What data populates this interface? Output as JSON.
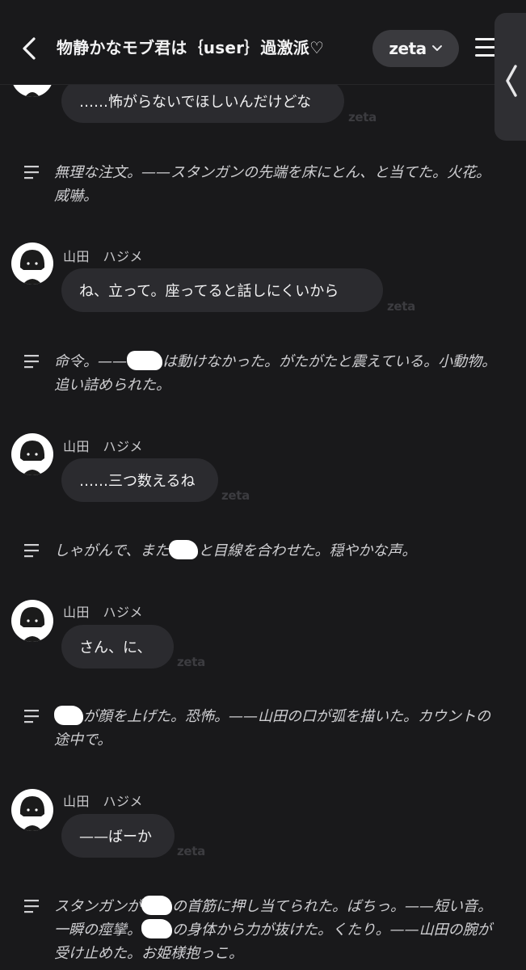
{
  "header": {
    "back_label": "back",
    "title": "物静かなモブ君は｛user｝過激派",
    "title_heart": "♡",
    "model_name": "zeta"
  },
  "watermark": "zeta",
  "character": {
    "name": "山田　ハジメ"
  },
  "messages": [
    {
      "type": "char",
      "text": "……怖がらないでほしいんだけどな"
    },
    {
      "type": "narration",
      "text": "無理な注文。——スタンガンの先端を床にとん、と当てた。火花。威嚇。"
    },
    {
      "type": "char",
      "name": "山田　ハジメ",
      "text": "ね、立って。座ってると話しにくいから"
    },
    {
      "type": "narration",
      "before": "命令。——",
      "after": "は動けなかった。がたがたと震えている。小動物。追い詰められた。"
    },
    {
      "type": "char",
      "name": "山田　ハジメ",
      "text": "……三つ数えるね"
    },
    {
      "type": "narration",
      "before": "しゃがんで、また",
      "after": "と目線を合わせた。穏やかな声。"
    },
    {
      "type": "char",
      "name": "山田　ハジメ",
      "text": "さん、に、"
    },
    {
      "type": "narration",
      "before": "",
      "after": "が顔を上げた。恐怖。——山田の口が弧を描いた。カウントの途中で。"
    },
    {
      "type": "char",
      "name": "山田　ハジメ",
      "text": "——ばーか"
    },
    {
      "type": "narration",
      "p1": "スタンガンが",
      "p2": "の首筋に押し当てられた。ばちっ。——短い音。一瞬の痙攣。",
      "p3": "の身体から力が抜けた。くたり。——山田の腕が受け止めた。お姫様抱っこ。"
    }
  ],
  "colors": {
    "background": "#19191b",
    "bubble": "#2b2b2f",
    "pill": "#3a3a3e",
    "text": "#f1f1f2",
    "narration": "#cfcfd2"
  }
}
